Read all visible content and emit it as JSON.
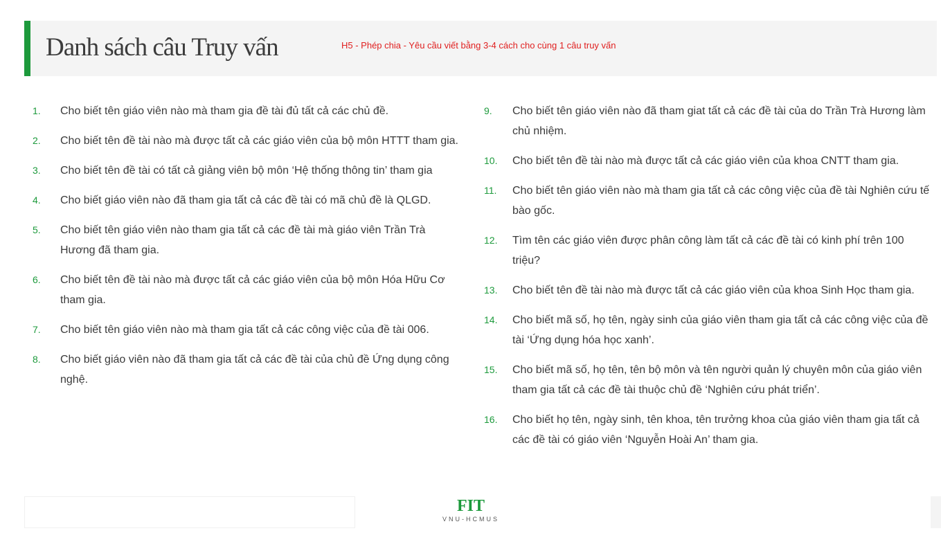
{
  "header": {
    "title": "Danh sách câu Truy vấn",
    "subtitle": "H5 - Phép chia - Yêu cầu viết bằng 3-4 cách cho cùng 1 câu truy vấn",
    "accent_color": "#1d9a3c",
    "subtitle_color": "#e02020"
  },
  "left_items": [
    {
      "num": "1.",
      "text": "Cho biết tên giáo viên nào mà tham gia đề tài đủ tất cả các chủ đề."
    },
    {
      "num": "2.",
      "text": "Cho biết tên đề tài nào mà được tất cả các giáo viên của bộ môn HTTT tham gia."
    },
    {
      "num": "3.",
      "text": "Cho biết tên đề tài có tất cả giảng viên bộ môn ‘Hệ thống thông tin’ tham gia"
    },
    {
      "num": "4.",
      "text": "Cho biết giáo viên nào đã tham gia tất cả các đề tài có mã chủ đề là QLGD."
    },
    {
      "num": "5.",
      "text": "Cho biết tên giáo viên nào tham gia tất cả các đề tài mà giáo viên Trần Trà Hương đã tham gia."
    },
    {
      "num": "6.",
      "text": "Cho biết tên đề tài nào mà được tất cả các giáo viên của bộ môn Hóa Hữu Cơ tham gia."
    },
    {
      "num": "7.",
      "text": "Cho biết tên giáo viên nào mà tham gia tất cả các công việc của đề tài 006."
    },
    {
      "num": "8.",
      "text": "Cho biết giáo viên nào đã tham gia tất cả các đề tài của chủ đề Ứng dụng công nghệ."
    }
  ],
  "right_items": [
    {
      "num": "9.",
      "text": "Cho biết tên giáo viên nào đã tham giat tất cả các đề tài của do Trần Trà Hương làm chủ nhiệm."
    },
    {
      "num": "10.",
      "text": "Cho biết tên đề tài nào mà được tất cả các giáo viên của khoa CNTT tham gia."
    },
    {
      "num": "11.",
      "text": "Cho biết tên giáo viên nào mà tham gia tất cả các công việc của đề tài Nghiên cứu tế bào gốc."
    },
    {
      "num": "12.",
      "text": "Tìm tên các giáo viên được phân công làm tất cả các đề tài có kinh phí trên 100 triệu?"
    },
    {
      "num": "13.",
      "text": "Cho biết tên đề tài nào mà được tất cả các giáo viên của khoa Sinh Học tham gia."
    },
    {
      "num": "14.",
      "text": "Cho biết mã số, họ tên, ngày sinh của giáo viên tham gia tất cả các công việc của đề tài ‘Ứng dụng hóa học xanh’."
    },
    {
      "num": "15.",
      "text": "Cho biết mã số, họ tên, tên bộ môn và tên người quản lý chuyên môn của giáo viên tham gia tất cả các đề tài thuộc chủ đề ‘Nghiên cứu phát triển’."
    },
    {
      "num": "16.",
      "text": "Cho biết họ tên, ngày sinh, tên khoa, tên trưởng khoa của giáo viên tham gia tất cả các đề tài có giáo viên ‘Nguyễn Hoài An’ tham gia."
    }
  ],
  "footer": {
    "logo_main": "FIT",
    "logo_sub": "VNU-HCMUS"
  }
}
